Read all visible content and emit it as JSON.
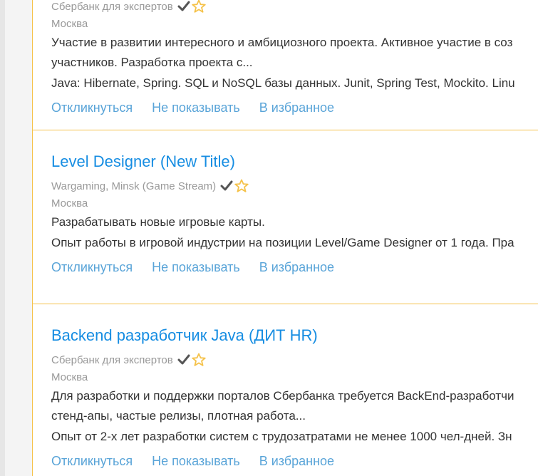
{
  "vacancies": [
    {
      "title": "",
      "company": "Сбербанк для экспертов",
      "city": "Москва",
      "description": "Участие в развитии интересного и амбициозного проекта. Активное участие в соз",
      "description_cont": "участников. Разработка проекта с...",
      "requirements": "Java: Hibernate, Spring. SQL и NoSQL базы данных. Junit, Spring Test, Mockito. Linu",
      "icons": [
        "check-icon",
        "star-icon"
      ]
    },
    {
      "title": "Level Designer (New Title)",
      "company": "Wargaming, Minsk (Game Stream)",
      "city": "Москва",
      "description": "Разрабатывать новые игровые карты.",
      "requirements": "Опыт работы в игровой индустрии на позиции Level/Game Designer от 1 года. Пра",
      "icons": [
        "check-icon",
        "star-icon"
      ]
    },
    {
      "title": "Backend разработчик Java (ДИТ HR)",
      "company": "Сбербанк для экспертов",
      "city": "Москва",
      "description": "Для разработки и поддержки порталов Сбербанка требуется BackEnd-разработчи",
      "description_cont": "стенд-апы, частые релизы, плотная работа...",
      "requirements": "Опыт от 2-х лет разработки систем с трудозатратами не менее 1000 чел-дней. Зн",
      "icons": [
        "check-icon",
        "star-icon"
      ]
    }
  ],
  "actions": {
    "respond": "Откликнуться",
    "hide": "Не показывать",
    "favorite": "В избранное"
  },
  "colors": {
    "title": "#168de2",
    "action": "#59a4d8",
    "meta": "#999999",
    "text": "#333333",
    "card_border": "#f5c24a",
    "star": "#f5c24a",
    "check": "#555555"
  }
}
